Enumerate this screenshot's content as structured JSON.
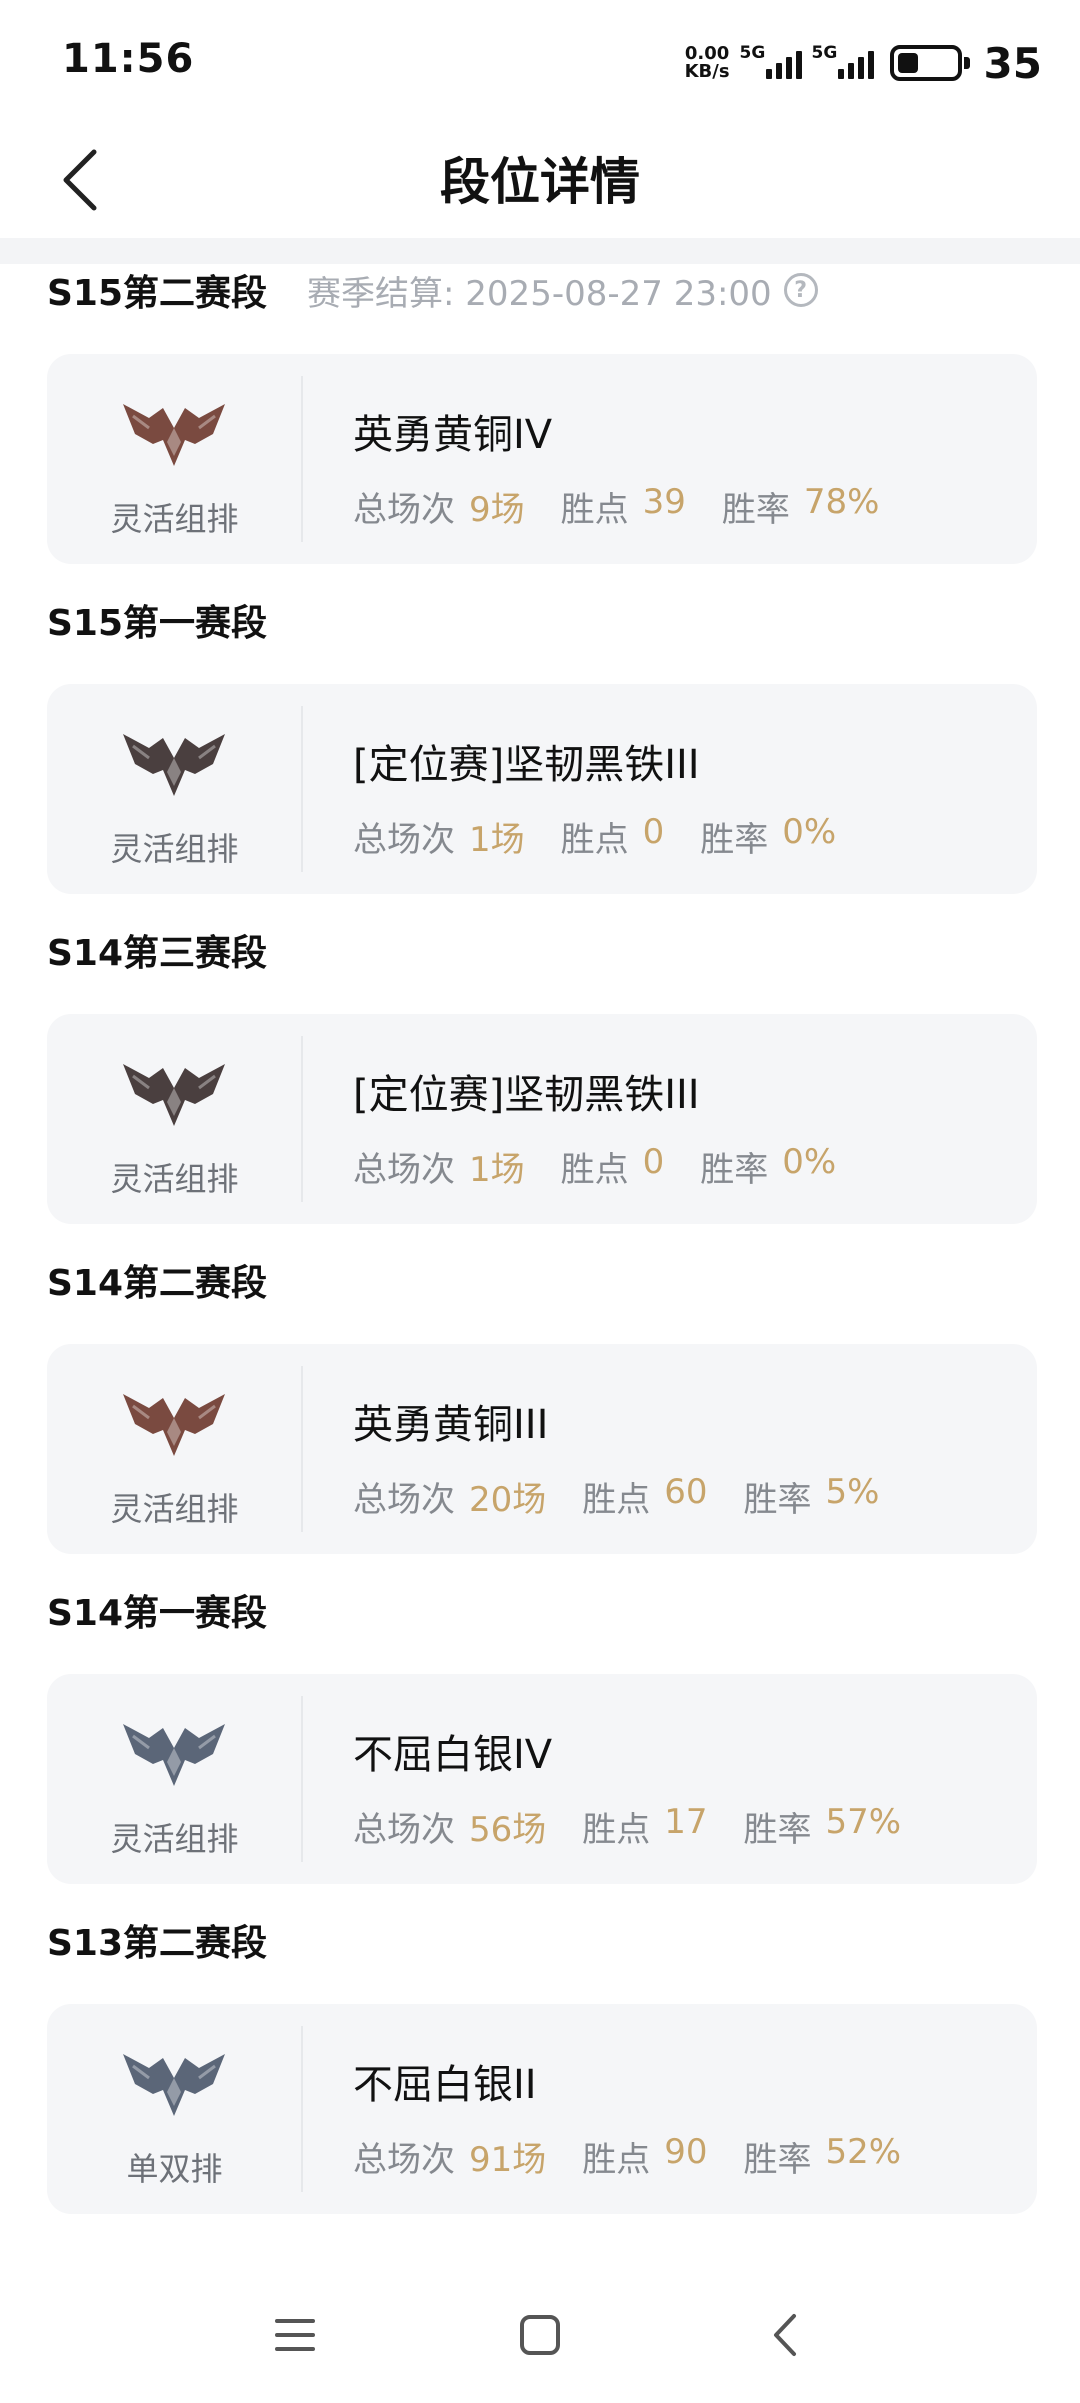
{
  "status_bar": {
    "time": "11:56",
    "net_speed_value": "0.00",
    "net_speed_unit": "KB/s",
    "sim1_label": "5G",
    "sim2_label": "5G",
    "battery_percent": "35",
    "battery_level": 0.35,
    "icons": [
      "signal-icon",
      "signal-icon",
      "battery-icon"
    ]
  },
  "header": {
    "title": "段位详情",
    "back_icon": "back-arrow-icon"
  },
  "settlement": {
    "label": "赛季结算: 2025-08-27 23:00",
    "help_icon": "help-circle-icon",
    "help_glyph": "?"
  },
  "stat_labels": {
    "games": "总场次",
    "points": "胜点",
    "winrate": "胜率"
  },
  "seasons": [
    {
      "season": "S15第二赛段",
      "queue": "灵活组排",
      "rank": "英勇黄铜IV",
      "games": "9场",
      "points": "39",
      "winrate": "78%",
      "tier": "bronze"
    },
    {
      "season": "S15第一赛段",
      "queue": "灵活组排",
      "rank": "[定位赛]坚韧黑铁III",
      "games": "1场",
      "points": "0",
      "winrate": "0%",
      "tier": "iron"
    },
    {
      "season": "S14第三赛段",
      "queue": "灵活组排",
      "rank": "[定位赛]坚韧黑铁III",
      "games": "1场",
      "points": "0",
      "winrate": "0%",
      "tier": "iron"
    },
    {
      "season": "S14第二赛段",
      "queue": "灵活组排",
      "rank": "英勇黄铜III",
      "games": "20场",
      "points": "60",
      "winrate": "5%",
      "tier": "bronze"
    },
    {
      "season": "S14第一赛段",
      "queue": "灵活组排",
      "rank": "不屈白银IV",
      "games": "56场",
      "points": "17",
      "winrate": "57%",
      "tier": "silver"
    },
    {
      "season": "S13第二赛段",
      "queue": "单双排",
      "rank": "不屈白银II",
      "games": "91场",
      "points": "90",
      "winrate": "52%",
      "tier": "silver"
    }
  ],
  "tier_colors": {
    "bronze": "#7a4a40",
    "iron": "#4a3f3f",
    "silver": "#5b6678"
  },
  "nav_bar": {
    "icons": [
      "menu-icon",
      "home-icon",
      "back-icon"
    ]
  }
}
